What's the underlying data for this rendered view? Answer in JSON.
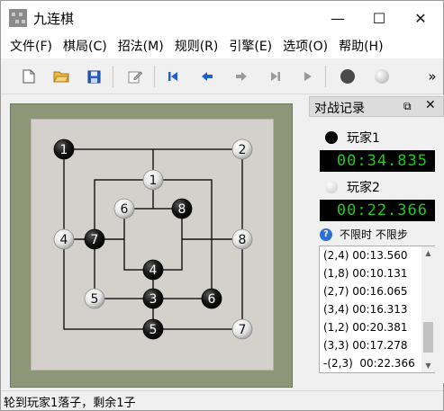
{
  "window": {
    "title": "九连棋",
    "controls": {
      "minimize": "—",
      "maximize": "☐",
      "close": "✕"
    }
  },
  "menu": [
    "文件(F)",
    "棋局(C)",
    "招法(M)",
    "规则(R)",
    "引擎(E)",
    "选项(O)",
    "帮助(H)"
  ],
  "toolbar": {
    "buttons": [
      "new-file",
      "open-folder",
      "save",
      "edit",
      "first-move",
      "previous-move",
      "next-move",
      "last-move",
      "play",
      "black-stone",
      "white-stone"
    ],
    "overflow": "»"
  },
  "board": {
    "stones": [
      {
        "color": "black",
        "label": "1"
      },
      {
        "color": "white",
        "label": "2"
      },
      {
        "color": "white",
        "label": "1"
      },
      {
        "color": "white",
        "label": "6"
      },
      {
        "color": "black",
        "label": "8"
      },
      {
        "color": "white",
        "label": "4"
      },
      {
        "color": "black",
        "label": "7"
      },
      {
        "color": "white",
        "label": "8"
      },
      {
        "color": "black",
        "label": "4"
      },
      {
        "color": "white",
        "label": "5"
      },
      {
        "color": "black",
        "label": "3"
      },
      {
        "color": "black",
        "label": "6"
      },
      {
        "color": "black",
        "label": "5"
      },
      {
        "color": "white",
        "label": "7"
      }
    ]
  },
  "panel": {
    "title": "对战记录",
    "float_icon": "⧉",
    "close_icon": "✕",
    "player1": {
      "name": "玩家1",
      "timer": "00:34.835",
      "color": "black"
    },
    "player2": {
      "name": "玩家2",
      "timer": "00:22.366",
      "color": "white"
    },
    "limit_icon": "?",
    "limit_text": "不限时 不限步",
    "records": [
      "(2,4) 00:13.560",
      "(1,8) 00:10.131",
      "(2,7) 00:16.065",
      "(3,4) 00:16.313",
      "(1,2) 00:20.381",
      "(3,3) 00:17.278",
      "-(2,3)  00:22.366"
    ]
  },
  "status": "轮到玩家1落子，剩余1子",
  "colors": {
    "timer_bg": "#000000",
    "timer_fg": "#21c721",
    "board_plate": "#d4d0cb",
    "board_frame": "#8d9778"
  }
}
